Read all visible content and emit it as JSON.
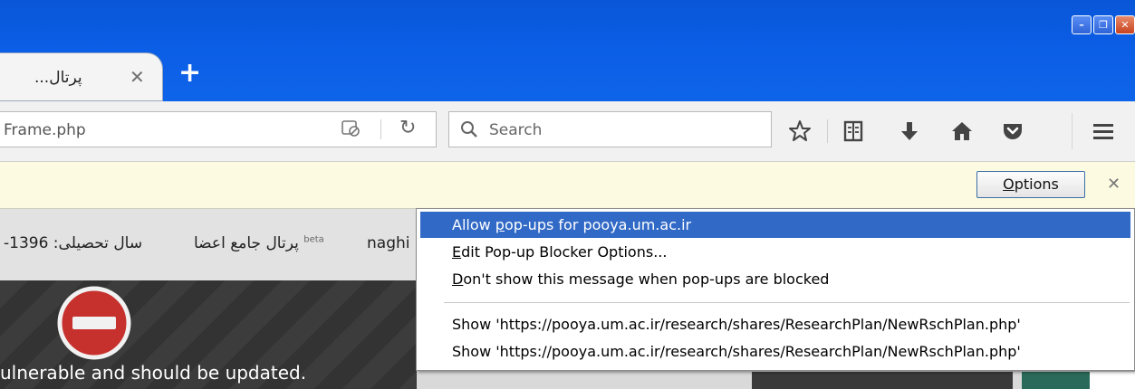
{
  "window": {
    "buttons": [
      "minimize",
      "restore",
      "close"
    ],
    "colors": {
      "titlebar": "#0b5ee6",
      "close": "#c8431f"
    }
  },
  "tab": {
    "title": "پرتال...",
    "close_icon": "close-icon",
    "new_tab_label": "+"
  },
  "toolbar": {
    "url": "Frame.php",
    "search_placeholder": "Search",
    "icons": [
      "page-info-icon",
      "reload-icon",
      "search-icon",
      "bookmark-star-icon",
      "reading-list-icon",
      "download-icon",
      "home-icon",
      "pocket-icon",
      "menu-icon"
    ]
  },
  "notification": {
    "options_label": "Options",
    "options_access_key": "O",
    "options_rest": "ptions",
    "close_icon": "close-icon"
  },
  "page": {
    "year_text": "سال تحصیلی: 1396-",
    "portal_text": "پرتال جامع اعضا",
    "beta_label": "beta",
    "user_text": "naghi",
    "stop_icon": "stop-icon",
    "message": "ulnerable and should be updated."
  },
  "popup_menu": {
    "items": [
      {
        "pre": "Allow ",
        "key": "p",
        "post": "op-ups for pooya.um.ac.ir",
        "highlighted": true
      },
      {
        "pre": "",
        "key": "E",
        "post": "dit Pop-up Blocker Options...",
        "highlighted": false
      },
      {
        "pre": "",
        "key": "D",
        "post": "on't show this message when pop-ups are blocked",
        "highlighted": false
      }
    ],
    "show_items": [
      "Show 'https://pooya.um.ac.ir/research/shares/ResearchPlan/NewRschPlan.php'",
      "Show 'https://pooya.um.ac.ir/research/shares/ResearchPlan/NewRschPlan.php'"
    ],
    "highlight_color": "#3169c6"
  }
}
